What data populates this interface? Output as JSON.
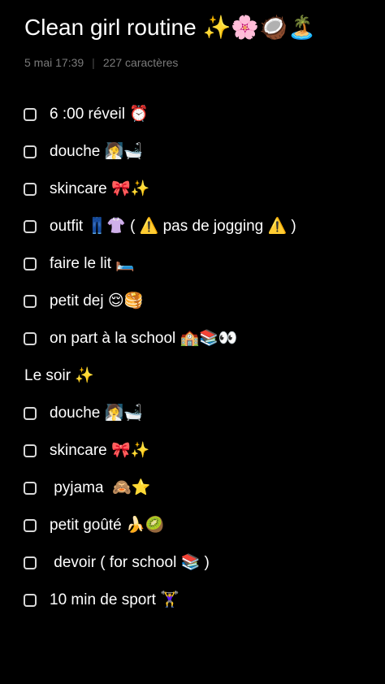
{
  "note": {
    "title": "Clean girl routine ✨🌸🥥🏝️",
    "date": "5 mai  17:39",
    "char_count": "227 caractères"
  },
  "morning_items": [
    {
      "text": "6 :00 réveil ⏰",
      "checked": false
    },
    {
      "text": "douche 🧖‍♀️🛁",
      "checked": false
    },
    {
      "text": "skincare 🎀✨",
      "checked": false
    },
    {
      "text": "outfit 👖👚 ( ⚠️ pas de jogging ⚠️ )",
      "checked": false
    },
    {
      "text": "faire le lit 🛏️",
      "checked": false
    },
    {
      "text": "petit dej 😌🥞",
      "checked": false
    },
    {
      "text": "on part à la school 🏫📚👀",
      "checked": false
    }
  ],
  "evening_header": "Le soir ✨",
  "evening_items": [
    {
      "text": "douche 🧖‍♀️🛁",
      "checked": false
    },
    {
      "text": "skincare 🎀✨",
      "checked": false
    },
    {
      "text": " pyjama  🙈⭐",
      "checked": false
    },
    {
      "text": "petit goûté 🍌🥝",
      "checked": false
    },
    {
      "text": " devoir ( for school 📚 )",
      "checked": false
    },
    {
      "text": "10 min de sport 🏋️‍♀️",
      "checked": false
    }
  ]
}
